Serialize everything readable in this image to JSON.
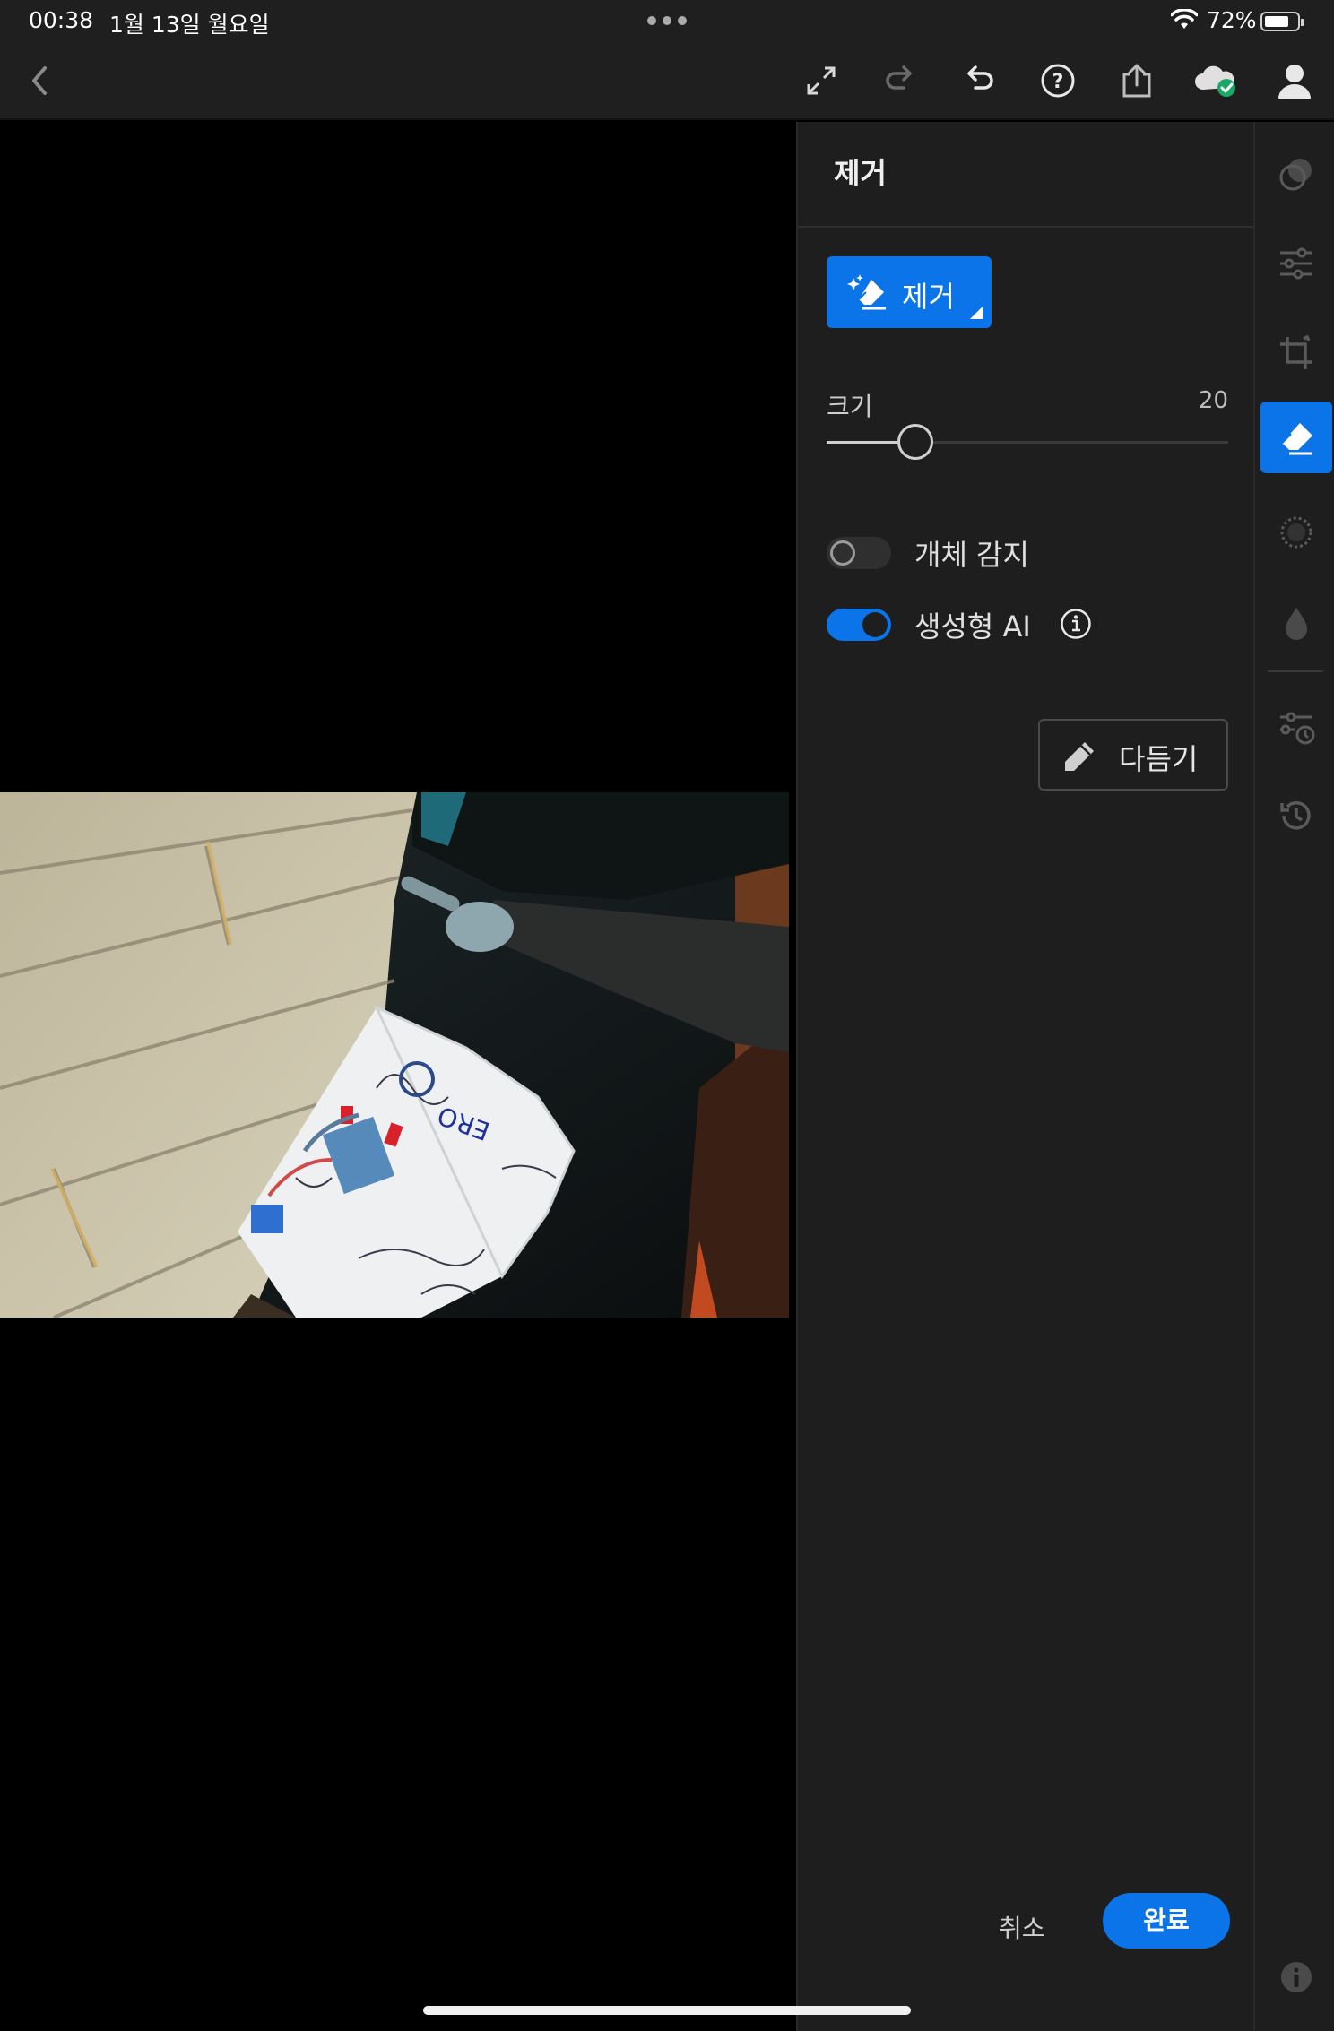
{
  "status_bar": {
    "time": "00:38",
    "date": "1월 13일 월요일",
    "battery_percent": "72%",
    "battery_level": 0.72
  },
  "toolbar": {
    "icons": [
      "back-icon",
      "expand-icon",
      "redo-icon",
      "undo-icon",
      "help-icon",
      "share-icon",
      "cloud-synced-icon",
      "profile-icon"
    ]
  },
  "panel": {
    "title": "제거",
    "remove_button_label": "제거",
    "size_label": "크기",
    "size_value": "20",
    "size_fraction": 0.22,
    "object_detect_label": "개체 감지",
    "object_detect_on": false,
    "generative_ai_label": "생성형 AI",
    "generative_ai_on": true,
    "refine_label": "다듬기",
    "cancel_label": "취소",
    "done_label": "완료"
  },
  "rail": {
    "items": [
      "presets-icon",
      "adjust-sliders-icon",
      "crop-icon",
      "eraser-icon",
      "masking-icon",
      "blur-icon",
      "versions-icon",
      "history-icon",
      "info-icon"
    ],
    "active": "eraser-icon"
  },
  "colors": {
    "accent": "#0a74e8",
    "panel_bg": "#1e1e1e",
    "cloud_check": "#1aa866"
  }
}
